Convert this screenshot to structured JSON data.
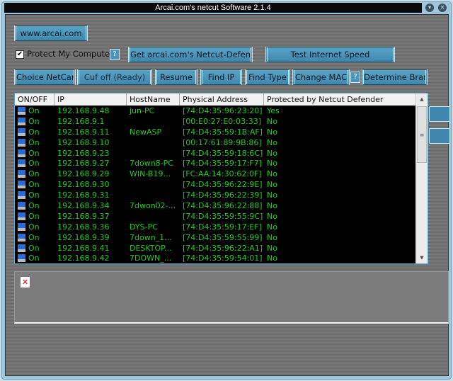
{
  "window": {
    "title": "Arcai.com's netcut Software 2.1.4"
  },
  "toolbar": {
    "website": "www.arcai.com",
    "protect_label": "Protect My Computer",
    "protect_checked": true,
    "help": "?",
    "get_defender": "Get arcai.com's Netcut-Defender",
    "test_speed": "Test Internet Speed",
    "choice_netcard": "Choice NetCard",
    "cut_off": "Cuf off (Ready)",
    "resume": "Resume",
    "find_ip": "Find IP",
    "find_type": "Find Type",
    "change_mac": "Change MAC",
    "determine_brand": "Determine Brand"
  },
  "table": {
    "columns": [
      "ON/OFF",
      "IP",
      "HostName",
      "Physical Address",
      "Protected by Netcut Defender"
    ],
    "rows": [
      [
        "On",
        "192.168.9.48",
        "jun-PC",
        "[74:D4:35:96:23:20]",
        "Yes"
      ],
      [
        "On",
        "192.168.9.1",
        "",
        "[00:E0:27:E0:03:33]",
        "No"
      ],
      [
        "On",
        "192.168.9.11",
        "NewASP",
        "[74:D4:35:59:1B:AF]",
        "No"
      ],
      [
        "On",
        "192.168.9.10",
        "",
        "[00:17:61:89:9B:86]",
        "No"
      ],
      [
        "On",
        "192.168.9.23",
        "",
        "[74:D4:35:59:18:6C]",
        "No"
      ],
      [
        "On",
        "192.168.9.27",
        "7down8-PC",
        "[74:D4:35:59:17:F7]",
        "No"
      ],
      [
        "On",
        "192.168.9.29",
        "WIN-B19...",
        "[FC:AA:14:30:62:0F]",
        "No"
      ],
      [
        "On",
        "192.168.9.30",
        "",
        "[74:D4:35:96:22:9E]",
        "No"
      ],
      [
        "On",
        "192.168.9.31",
        "",
        "[74:D4:35:96:22:39]",
        "No"
      ],
      [
        "On",
        "192.168.9.34",
        "7dwon02-...",
        "[74:D4:35:96:22:88]",
        "No"
      ],
      [
        "On",
        "192.168.9.37",
        "",
        "[74:D4:35:59:55:9C]",
        "No"
      ],
      [
        "On",
        "192.168.9.36",
        "DYS-PC",
        "[74:D4:35:59:17:EF]",
        "No"
      ],
      [
        "On",
        "192.168.9.39",
        "7down_1...",
        "[74:D4:35:59:55:99]",
        "No"
      ],
      [
        "On",
        "192.168.9.41",
        "DESKTOP...",
        "[74:D4:35:96:22:A1]",
        "No"
      ],
      [
        "On",
        "192.168.9.42",
        "7DOWN_...",
        "[74:D4:35:59:54:01]",
        "No"
      ]
    ]
  },
  "colors": {
    "row_text": "#1fcc1f",
    "button": "#4b95bb",
    "background": "#727272"
  }
}
